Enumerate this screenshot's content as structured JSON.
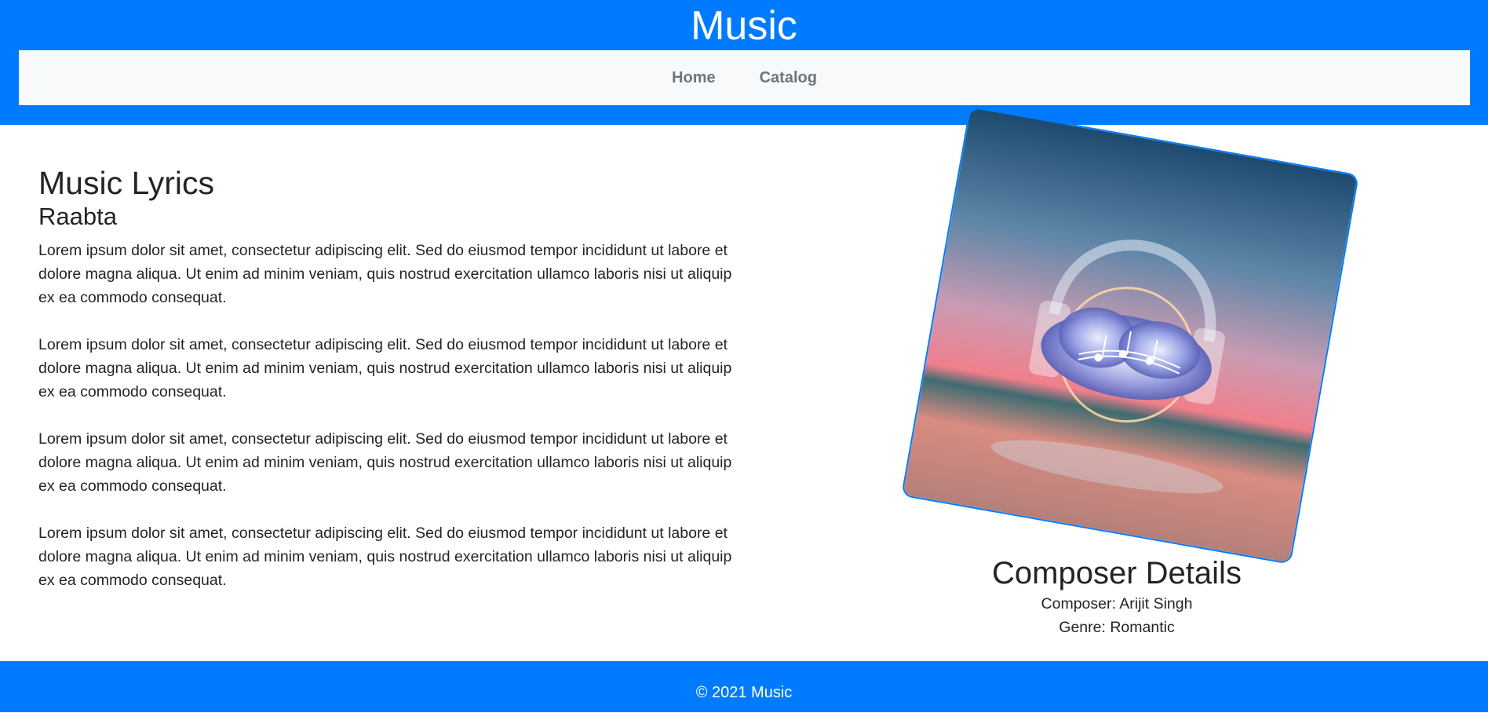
{
  "header": {
    "title": "Music",
    "nav": [
      {
        "label": "Home"
      },
      {
        "label": "Catalog"
      }
    ]
  },
  "main": {
    "heading": "Music Lyrics",
    "song_title": "Raabta",
    "paragraphs": [
      "Lorem ipsum dolor sit amet, consectetur adipiscing elit. Sed do eiusmod tempor incididunt ut labore et dolore magna aliqua. Ut enim ad minim veniam, quis nostrud exercitation ullamco laboris nisi ut aliquip ex ea commodo consequat.",
      "Lorem ipsum dolor sit amet, consectetur adipiscing elit. Sed do eiusmod tempor incididunt ut labore et dolore magna aliqua. Ut enim ad minim veniam, quis nostrud exercitation ullamco laboris nisi ut aliquip ex ea commodo consequat.",
      "Lorem ipsum dolor sit amet, consectetur adipiscing elit. Sed do eiusmod tempor incididunt ut labore et dolore magna aliqua. Ut enim ad minim veniam, quis nostrud exercitation ullamco laboris nisi ut aliquip ex ea commodo consequat.",
      "Lorem ipsum dolor sit amet, consectetur adipiscing elit. Sed do eiusmod tempor incididunt ut labore et dolore magna aliqua. Ut enim ad minim veniam, quis nostrud exercitation ullamco laboris nisi ut aliquip ex ea commodo consequat."
    ]
  },
  "composer": {
    "heading": "Composer Details",
    "composer_line": "Composer: Arijit Singh",
    "genre_line": "Genre: Romantic"
  },
  "footer": {
    "text": "© 2021 Music"
  },
  "colors": {
    "brand": "#007bff",
    "navbar_bg": "#f8f9fa",
    "nav_link": "#6c757d",
    "text": "#212529"
  },
  "album_art": {
    "icon": "headphones-cloud-music-notes"
  }
}
